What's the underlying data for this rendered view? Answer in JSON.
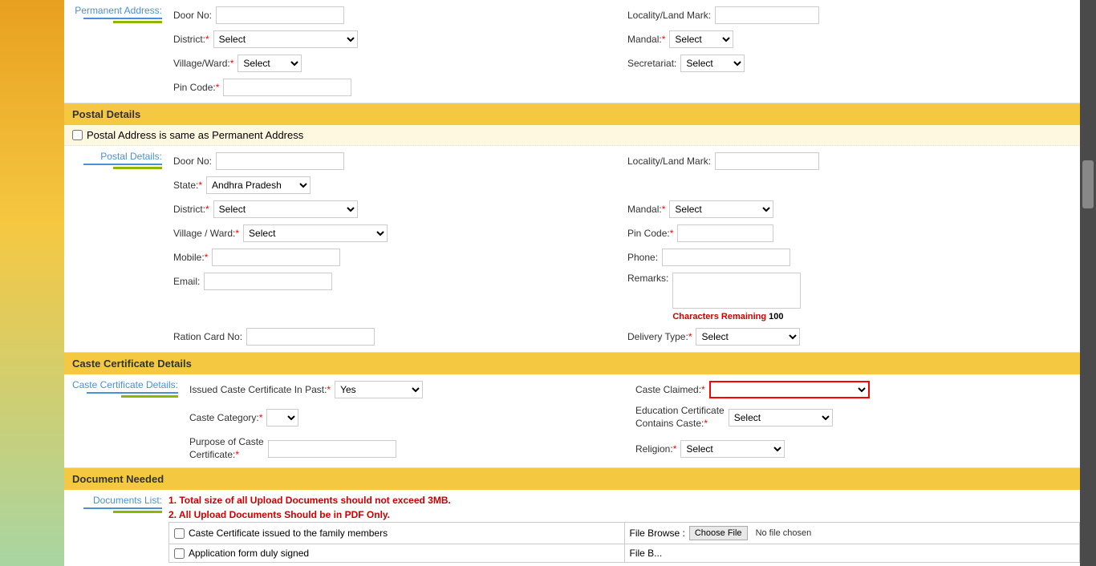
{
  "permanent_address": {
    "label": "Permanent Address:",
    "door_no_label": "Door No:",
    "locality_label": "Locality/Land Mark:",
    "district_label": "District:",
    "mandal_label": "Mandal:",
    "village_ward_label": "Village/Ward:",
    "secretariat_label": "Secretariat:",
    "pin_code_label": "Pin Code:",
    "select_text": "Select",
    "district_options": [
      "Select"
    ],
    "mandal_options": [
      "Select"
    ],
    "village_options": [
      "Select"
    ],
    "secretariat_options": [
      "Select"
    ]
  },
  "postal_details": {
    "section_header": "Postal Details",
    "checkbox_label": "Postal Address is same as Permanent Address",
    "side_label": "Postal Details:",
    "door_no_label": "Door No:",
    "locality_label": "Locality/Land Mark:",
    "state_label": "State:",
    "state_value": "Andhra Pradesh",
    "district_label": "District:",
    "mandal_label": "Mandal:",
    "village_ward_label": "Village / Ward:",
    "pin_code_label": "Pin Code:",
    "mobile_label": "Mobile:",
    "phone_label": "Phone:",
    "email_label": "Email:",
    "remarks_label": "Remarks:",
    "chars_remaining_label": "Characters Remaining",
    "chars_count": "100",
    "ration_card_label": "Ration Card No:",
    "delivery_type_label": "Delivery Type:",
    "district_options": [
      "Select"
    ],
    "mandal_options": [
      "Select"
    ],
    "village_options": [
      "Select"
    ],
    "select_text": "Select",
    "delivery_options": [
      "Select"
    ]
  },
  "caste_certificate": {
    "section_header": "Caste Certificate Details",
    "side_label": "Caste Certificate Details:",
    "issued_label": "Issued Caste Certificate In Past:",
    "issued_options": [
      "Yes"
    ],
    "caste_claimed_label": "Caste Claimed:",
    "caste_category_label": "Caste Category:",
    "education_label": "Education Certificate Contains Caste:",
    "education_options": [
      "Select"
    ],
    "purpose_label": "Purpose of Caste Certificate:",
    "religion_label": "Religion:",
    "religion_options": [
      "Select"
    ]
  },
  "document_needed": {
    "section_header": "Document Needed",
    "side_label": "Documents List:",
    "rule1": "1. Total size of all Upload Documents should not exceed 3MB.",
    "rule2": "2. All Upload Documents Should be in PDF Only.",
    "doc1_label": "Caste Certificate issued to the family members",
    "file_browse_label": "File Browse :",
    "choose_file_btn": "Choose File",
    "no_file_text": "No file chosen",
    "doc2_label": "Application form duly signed"
  }
}
